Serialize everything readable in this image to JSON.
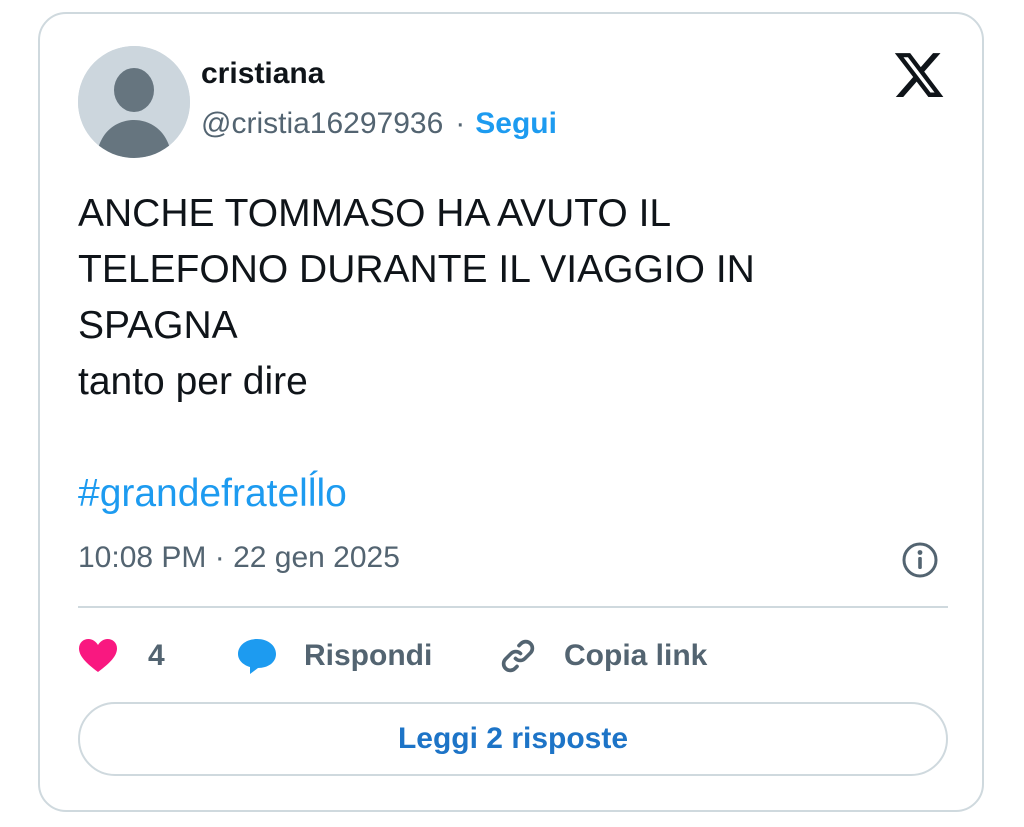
{
  "author": {
    "display_name": "cristiana",
    "handle": "@cristia16297936",
    "separator": "·",
    "follow_label": "Segui"
  },
  "platform": {
    "logo_icon": "x-logo-icon"
  },
  "tweet": {
    "text": "ANCHE TOMMASO HA AVUTO IL\nTELEFONO DURANTE IL VIAGGIO IN\nSPAGNA\ntanto per dire",
    "hashtag": "#grandefratelĺlo",
    "timestamp": "10:08 PM · 22 gen 2025"
  },
  "actions": {
    "like_count": "4",
    "reply_label": "Rispondi",
    "copy_link_label": "Copia link"
  },
  "read_replies_label": "Leggi 2 risposte",
  "colors": {
    "accent": "#1d9bf0",
    "like": "#f91880",
    "text_primary": "#0f1419",
    "text_secondary": "#536471",
    "border": "#cfd9de"
  }
}
